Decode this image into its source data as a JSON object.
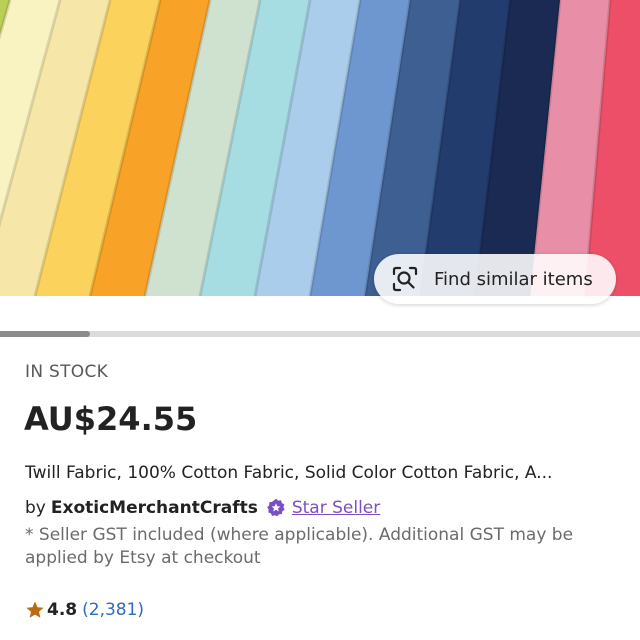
{
  "product_image": {
    "alt": "folded cotton fabric in assorted solid colors",
    "swatch_colors": [
      "#b9cf57",
      "#f9f3c2",
      "#f6e7a9",
      "#fbd25c",
      "#f8a227",
      "#cfe2cf",
      "#a6dde3",
      "#a9cdeb",
      "#6f97cf",
      "#3d5f92",
      "#233c6e",
      "#1a2a52",
      "#e88ea6",
      "#ee4f68"
    ]
  },
  "find_similar": {
    "label": "Find similar items",
    "icon": "visual-search-icon"
  },
  "image_carousel": {
    "position_fraction": 0.14
  },
  "listing": {
    "stock_status": "IN STOCK",
    "price": "AU$24.55",
    "title": "Twill Fabric, 100% Cotton Fabric, Solid Color Cotton Fabric, A...",
    "seller_prefix": "by",
    "shop_name": "ExoticMerchantCrafts",
    "seller_badge": "Star Seller",
    "gst_note": "* Seller GST included (where applicable). Additional GST may be applied by Etsy at checkout",
    "rating": "4.8",
    "review_count": "(2,381)"
  },
  "colors": {
    "accent_purple": "#7b4fc2",
    "star": "#b86b12",
    "link_blue": "#2d6bbf"
  }
}
